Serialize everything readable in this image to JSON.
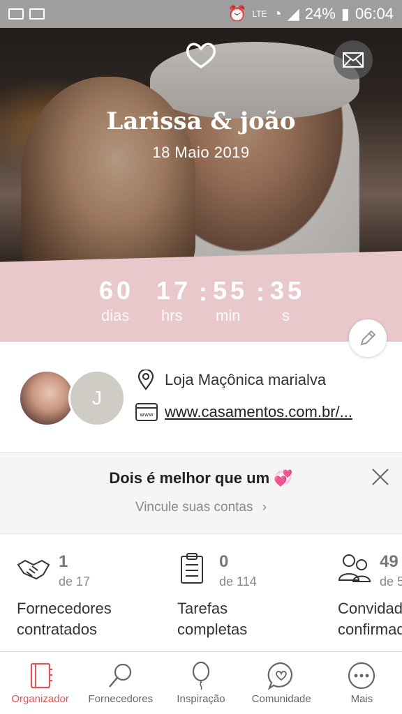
{
  "status_bar": {
    "battery": "24%",
    "time": "06:04",
    "network": "LTE"
  },
  "hero": {
    "couple_name": "Larissa & joão",
    "date": "18 Maio 2019"
  },
  "countdown": {
    "days": "60",
    "hours": "17",
    "minutes": "55",
    "seconds": "35",
    "days_label": "dias",
    "hours_label": "hrs",
    "minutes_label": "min",
    "seconds_label": "s"
  },
  "profile": {
    "avatar_initial": "J",
    "venue": "Loja Maçônica marialva",
    "website": "www.casamentos.com.br/..."
  },
  "banner": {
    "title": "Dois é melhor que um 💞",
    "link": "Vincule suas contas"
  },
  "stats": [
    {
      "count": "1",
      "total": "de 17",
      "label_line1": "Fornecedores",
      "label_line2": "contratados"
    },
    {
      "count": "0",
      "total": "de 114",
      "label_line1": "Tarefas",
      "label_line2": "completas"
    },
    {
      "count": "49",
      "total": "de 5",
      "label_line1": "Convidados",
      "label_line2": "confirmados"
    }
  ],
  "nav": [
    {
      "label": "Organizador",
      "icon": "planner-icon",
      "active": true
    },
    {
      "label": "Fornecedores",
      "icon": "search-icon",
      "active": false
    },
    {
      "label": "Inspiração",
      "icon": "balloon-icon",
      "active": false
    },
    {
      "label": "Comunidade",
      "icon": "chat-heart-icon",
      "active": false
    },
    {
      "label": "Mais",
      "icon": "more-icon",
      "active": false
    }
  ],
  "colors": {
    "countdown_bg": "#e8c8cb",
    "active_nav": "#e05555",
    "status_bar_bg": "#9e9e9e"
  }
}
